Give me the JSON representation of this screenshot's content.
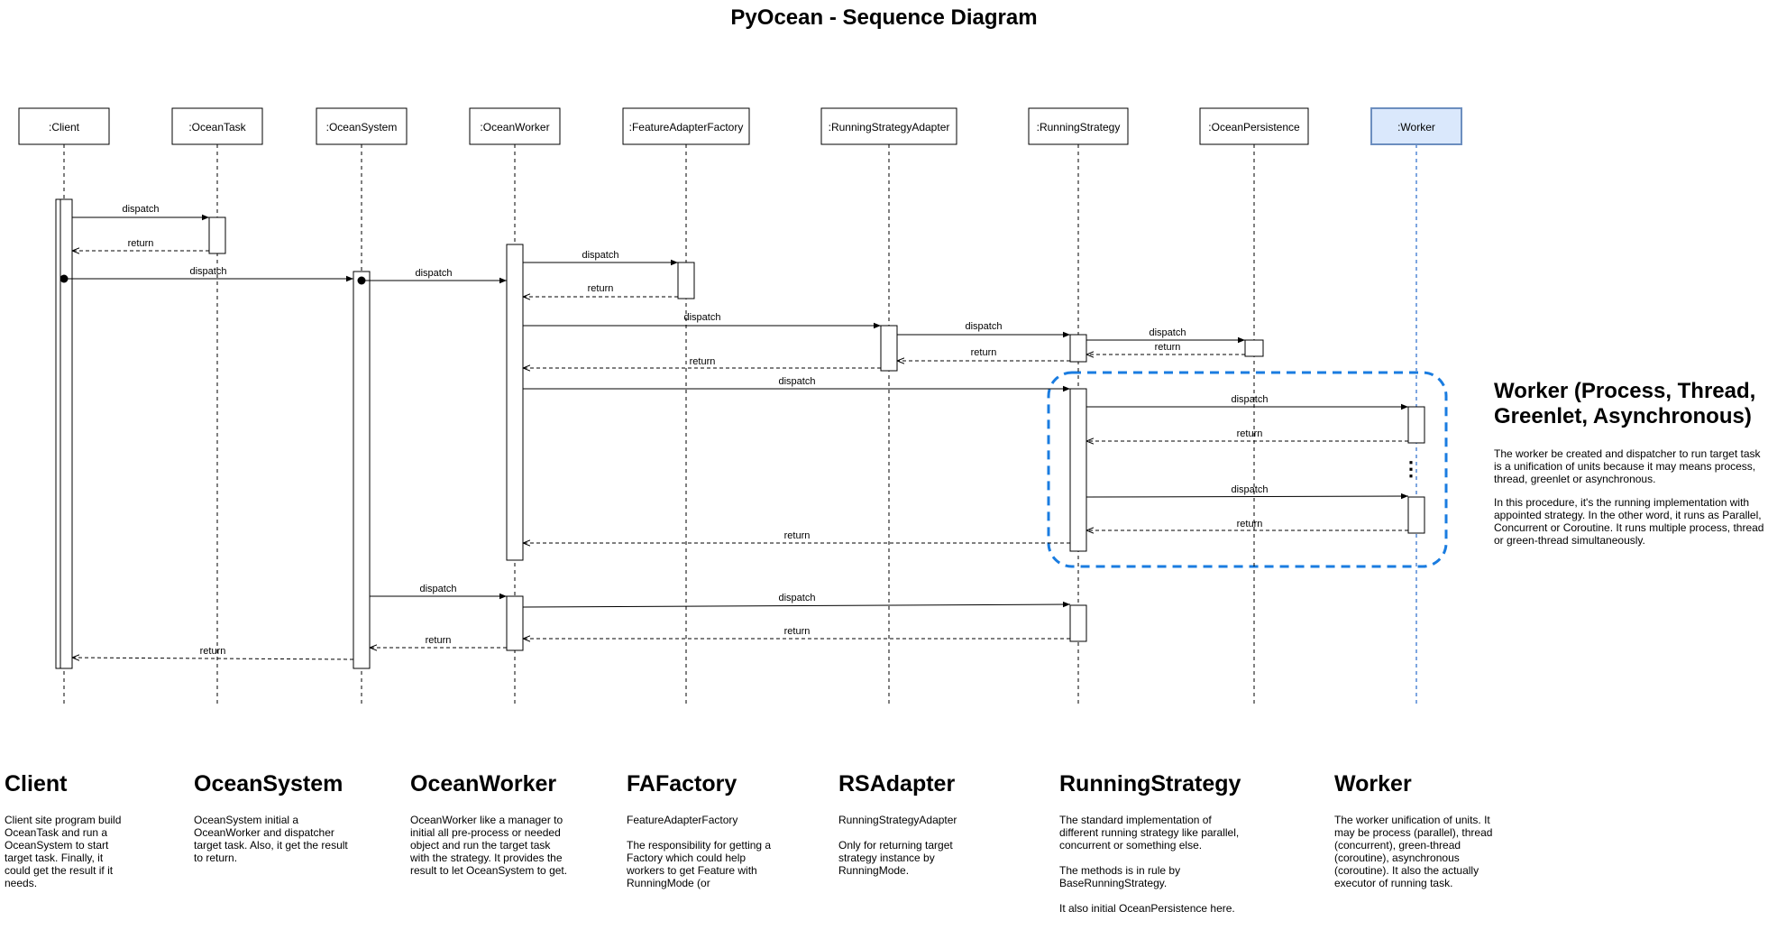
{
  "title": "PyOcean - Sequence Diagram",
  "participants": [
    ":Client",
    ":OceanTask",
    ":OceanSystem",
    ":OceanWorker",
    ":FeatureAdapterFactory",
    ":RunningStrategyAdapter",
    ":RunningStrategy",
    ":OceanPersistence",
    ":Worker"
  ],
  "messages": [
    "dispatch",
    "return",
    "dispatch",
    "dispatch",
    "dispatch",
    "return",
    "dispatch",
    "dispatch",
    "dispatch",
    "return",
    "return",
    "return",
    "dispatch",
    "dispatch",
    "return",
    "dispatch",
    "return",
    "return",
    "dispatch",
    "dispatch",
    "return",
    "return",
    "return"
  ],
  "worker_note": {
    "title": "Worker (Process, Thread, Greenlet, Asynchronous)",
    "paragraphs": [
      "The worker be created and dispatcher to run target task is a unification of units because it may means process, thread, greenlet or asynchronous.",
      "In this procedure, it's the running implementation with appointed strategy. In the other word, it runs as Parallel, Concurrent or Coroutine. It runs multiple process, thread or green-thread simultaneously."
    ]
  },
  "ellipsis": "⋮",
  "notes": [
    {
      "title": "Client",
      "paragraphs": [
        "Client site program build OceanTask and run a OceanSystem to start target task. Finally, it could get the result if it needs."
      ]
    },
    {
      "title": "OceanSystem",
      "paragraphs": [
        "OceanSystem initial a OceanWorker and dispatcher target task. Also, it get the result to return."
      ]
    },
    {
      "title": "OceanWorker",
      "paragraphs": [
        "OceanWorker like a manager to initial all pre-process or needed object and run the target task with the strategy. It provides the result to let OceanSystem to get."
      ]
    },
    {
      "title": "FAFactory",
      "paragraphs": [
        "FeatureAdapterFactory",
        "The responsibility for getting a Factory which could help workers to get Feature with RunningMode (or FeatureMode) for running"
      ]
    },
    {
      "title": "RSAdapter",
      "paragraphs": [
        "RunningStrategyAdapter",
        "Only for returning target strategy instance by RunningMode."
      ]
    },
    {
      "title": "RunningStrategy",
      "paragraphs": [
        "The standard implementation of different running strategy like parallel, concurrent or something else.",
        "The methods is in rule by BaseRunningStrategy.",
        "It also initial OceanPersistence here."
      ]
    },
    {
      "title": "Worker",
      "paragraphs": [
        "The worker unification of units. It may be process (parallel), thread (concurrent), green-thread (coroutine), asynchronous (coroutine). It also the actually executor of running task."
      ]
    }
  ],
  "colors": {
    "line": "#000000",
    "worker_box_fill": "#dae8fc",
    "worker_box_stroke": "#6c8ebf",
    "worker_lifeline": "#7ea6e0",
    "highlight_dash": "#1a7ce0"
  }
}
